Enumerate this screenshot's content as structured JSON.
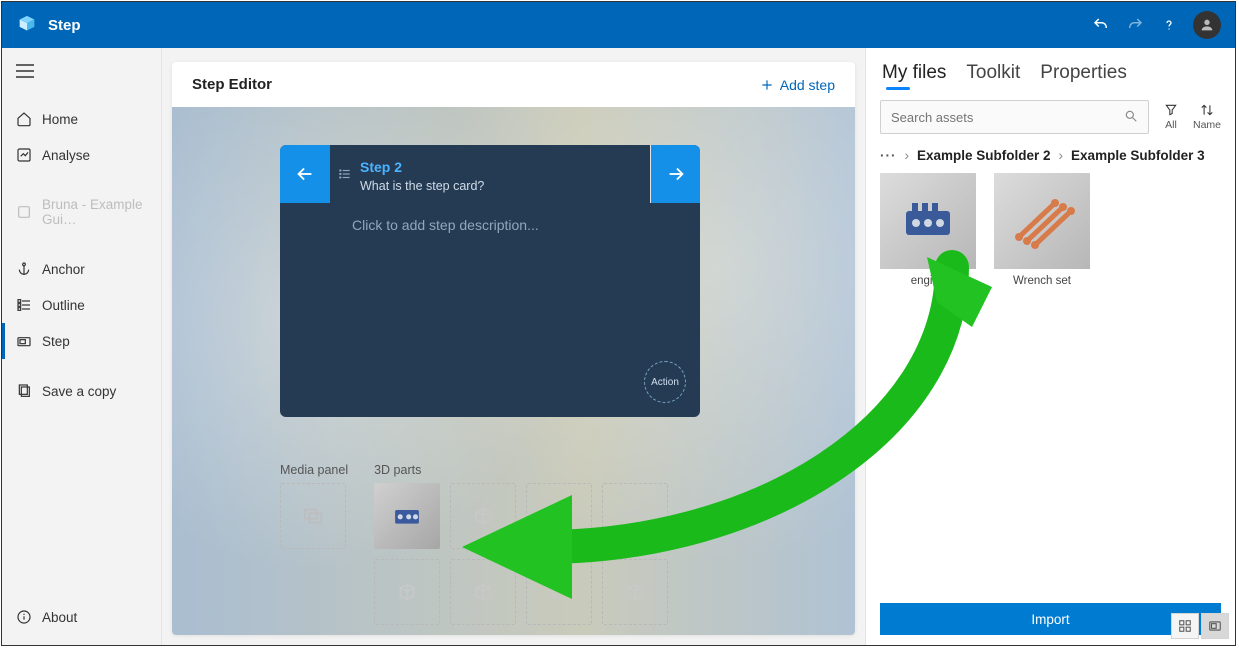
{
  "titlebar": {
    "app_name": "Step"
  },
  "sidebar": {
    "items": [
      {
        "label": "Home"
      },
      {
        "label": "Analyse"
      },
      {
        "label": "Bruna - Example Gui…"
      },
      {
        "label": "Anchor"
      },
      {
        "label": "Outline"
      },
      {
        "label": "Step"
      },
      {
        "label": "Save a copy"
      }
    ],
    "about_label": "About"
  },
  "editor": {
    "title": "Step Editor",
    "add_step_label": "Add step",
    "step": {
      "title": "Step 2",
      "subtitle": "What is the step card?",
      "placeholder": "Click to add step description...",
      "action_label": "Action"
    },
    "media_panel_label": "Media panel",
    "parts_label": "3D parts"
  },
  "right": {
    "tabs": [
      {
        "label": "My files"
      },
      {
        "label": "Toolkit"
      },
      {
        "label": "Properties"
      }
    ],
    "search_placeholder": "Search assets",
    "filter_label": "All",
    "sort_label": "Name",
    "breadcrumbs": [
      {
        "label": "Example Subfolder 2"
      },
      {
        "label": "Example Subfolder 3"
      }
    ],
    "files": [
      {
        "label": "engine"
      },
      {
        "label": "Wrench set"
      }
    ],
    "import_label": "Import"
  }
}
